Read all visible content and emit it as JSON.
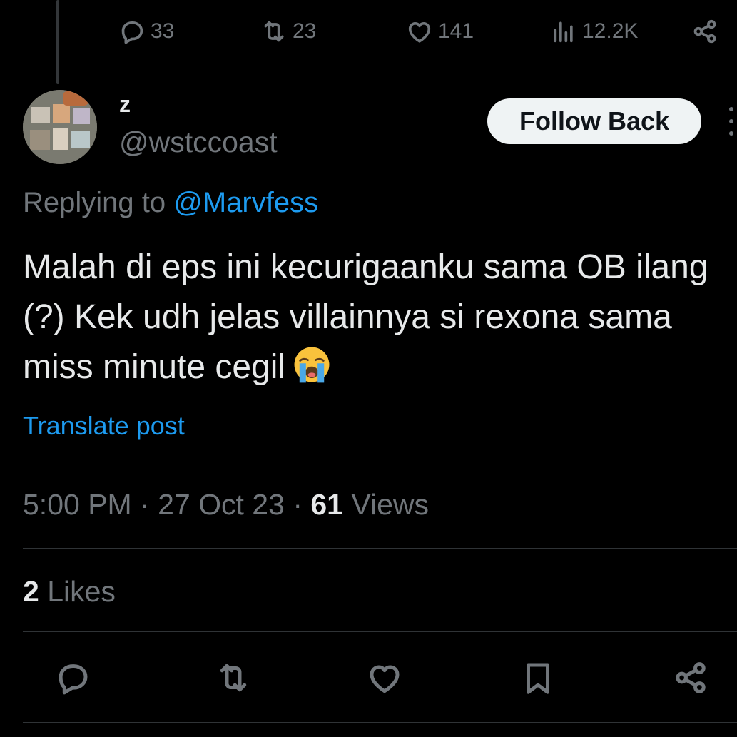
{
  "parent_metrics": {
    "replies": "33",
    "retweets": "23",
    "likes": "141",
    "views": "12.2K"
  },
  "author": {
    "display_name": "z",
    "handle": "@wstccoast"
  },
  "follow_button": "Follow Back",
  "replying": {
    "prefix": "Replying to ",
    "mention": "@Marvfess"
  },
  "tweet": {
    "text": "Malah di eps ini kecurigaanku sama OB ilang (?) Kek udh jelas villainnya si rexona sama miss minute cegil",
    "emoji": "loudly-crying-face"
  },
  "translate_label": "Translate post",
  "timestamp": {
    "time": "5:00 PM",
    "sep1": " · ",
    "date": "27 Oct 23",
    "sep2": " · ",
    "views_count": "61",
    "views_label": " Views"
  },
  "likes_summary": {
    "count": "2",
    "label": " Likes"
  },
  "icons": {
    "reply": "reply-icon",
    "retweet": "retweet-icon",
    "like": "heart-icon",
    "views": "views-icon",
    "share": "share-icon",
    "bookmark": "bookmark-icon",
    "more": "more-icon"
  },
  "colors": {
    "background": "#000000",
    "text_primary": "#e7e9ea",
    "text_secondary": "#71767b",
    "accent": "#1d9bf0",
    "divider": "#2f3336",
    "button_bg": "#eff3f4"
  }
}
